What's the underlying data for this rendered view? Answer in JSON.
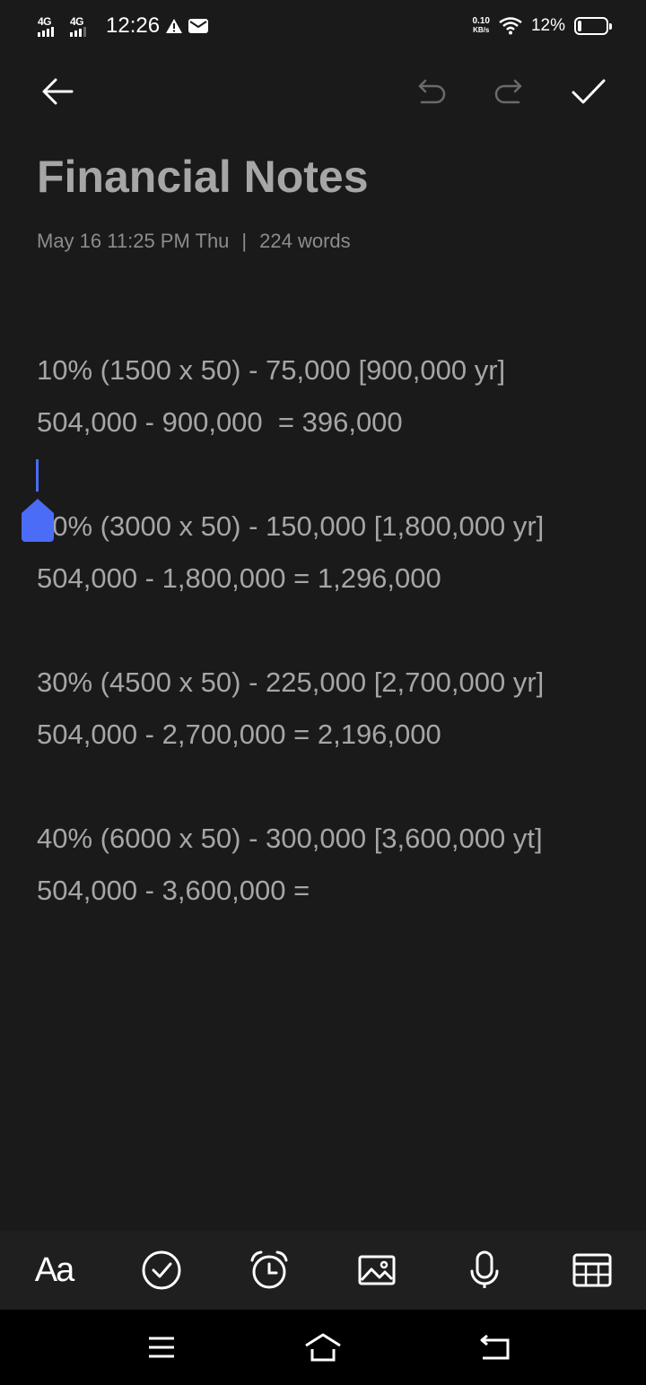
{
  "status_bar": {
    "signal1_label": "4G",
    "signal2_label": "4G",
    "time": "12:26",
    "net_speed_value": "0.10",
    "net_speed_unit": "KB/s",
    "battery_percent": "12%",
    "battery_level": 0.12
  },
  "toolbar": {
    "back_icon": "arrow-left-icon",
    "undo_icon": "undo-icon",
    "redo_icon": "redo-icon",
    "done_icon": "checkmark-icon"
  },
  "note": {
    "title": "Financial Notes",
    "date": "May 16 11:25 PM Thu",
    "separator": "|",
    "word_count": "224 words",
    "lines": [
      "10% (1500 x 50) - 75,000 [900,000 yr]",
      "504,000 - 900,000  = 396,000",
      "",
      "20% (3000 x 50) - 150,000 [1,800,000 yr]",
      "504,000 - 1,800,000 = 1,296,000",
      "",
      "30% (4500 x 50) - 225,000 [2,700,000 yr]",
      "504,000 - 2,700,000 = 2,196,000",
      "",
      "40% (6000 x 50) - 300,000 [3,600,000 yt]",
      "504,000 - 3,600,000 ="
    ]
  },
  "bottom_tools": {
    "format_label": "Aa",
    "items": [
      "text-format-icon",
      "checklist-icon",
      "alarm-clock-icon",
      "image-icon",
      "microphone-icon",
      "table-icon"
    ]
  },
  "nav_bar": {
    "items": [
      "menu-icon",
      "home-icon",
      "back-nav-icon"
    ]
  },
  "colors": {
    "background": "#1a1a1b",
    "text": "#a6a6a6",
    "cursor": "#4a6cf7"
  }
}
